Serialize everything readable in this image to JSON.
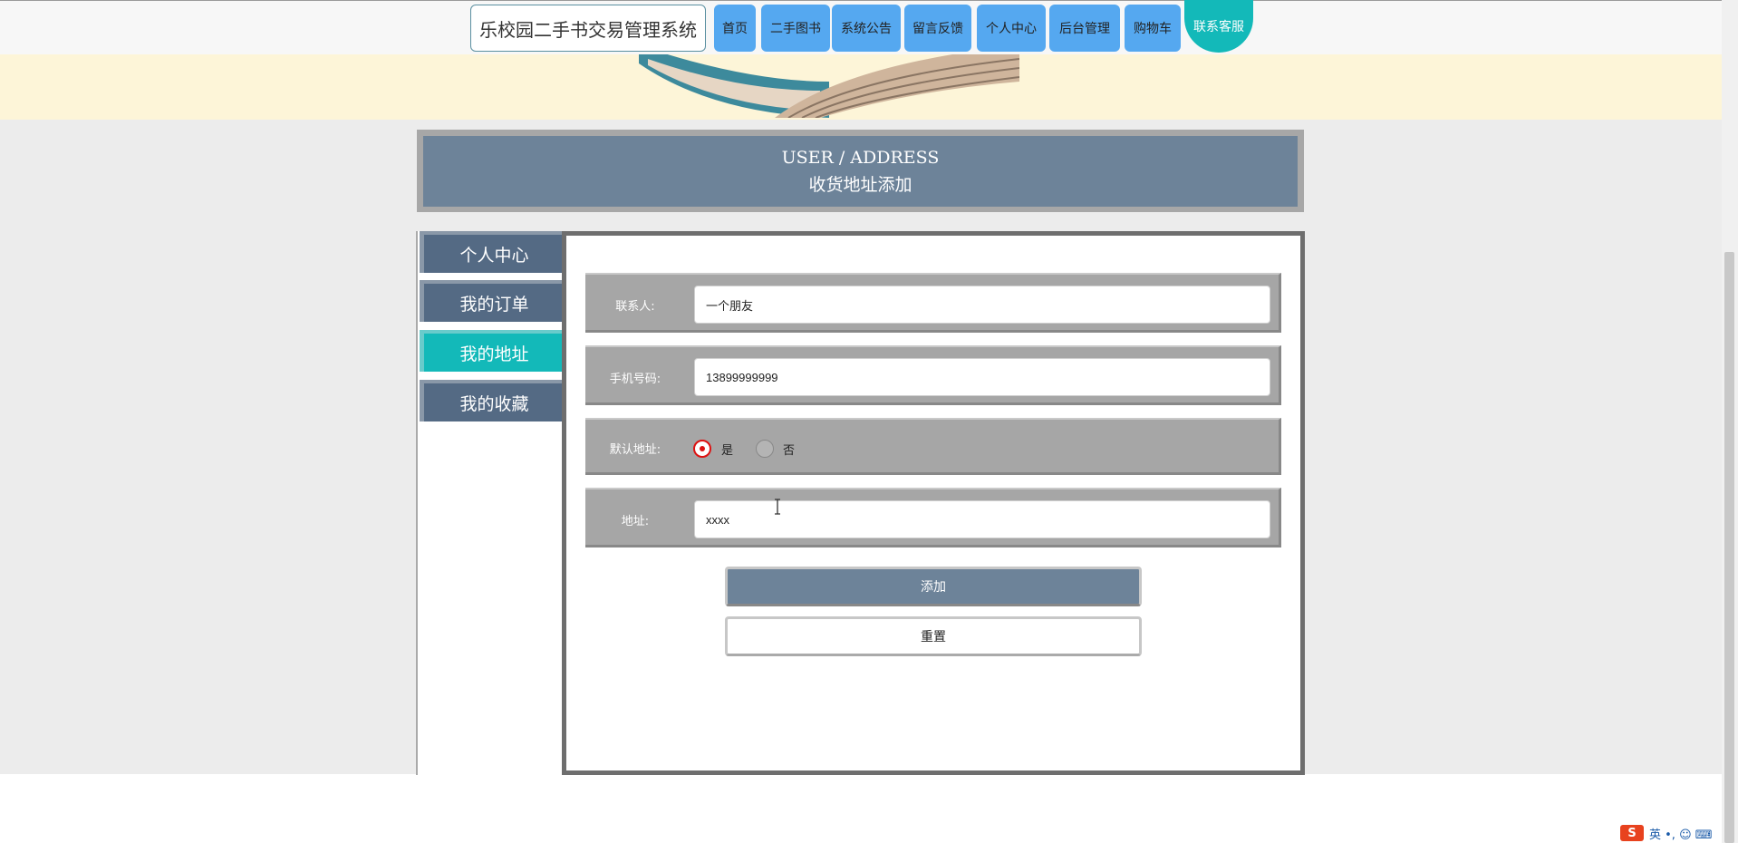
{
  "site_title": "乐校园二手书交易管理系统",
  "nav": {
    "home": "首页",
    "books": "二手图书",
    "notice": "系统公告",
    "feedback": "留言反馈",
    "profile": "个人中心",
    "admin": "后台管理",
    "cart": "购物车",
    "contact": "联系客服"
  },
  "header": {
    "en": "USER / ADDRESS",
    "cn": "收货地址添加"
  },
  "sidebar": {
    "items": [
      {
        "label": "个人中心",
        "active": false
      },
      {
        "label": "我的订单",
        "active": false
      },
      {
        "label": "我的地址",
        "active": true
      },
      {
        "label": "我的收藏",
        "active": false
      }
    ]
  },
  "form": {
    "contact_label": "联系人:",
    "contact_value": "一个朋友",
    "phone_label": "手机号码:",
    "phone_value": "13899999999",
    "default_label": "默认地址:",
    "default_yes": "是",
    "default_no": "否",
    "default_selected": "是",
    "address_label": "地址:",
    "address_value": "xxxx",
    "add_button": "添加",
    "reset_button": "重置"
  },
  "tray": {
    "ime_logo": "S",
    "ime_text": "英 •, ☺ ⌨"
  },
  "colors": {
    "nav_button": "#55a8f0",
    "accent_teal": "#13b9b9",
    "slate": "#6d8399",
    "sidebar": "#546a84",
    "row_gray": "#a6a6a6"
  }
}
